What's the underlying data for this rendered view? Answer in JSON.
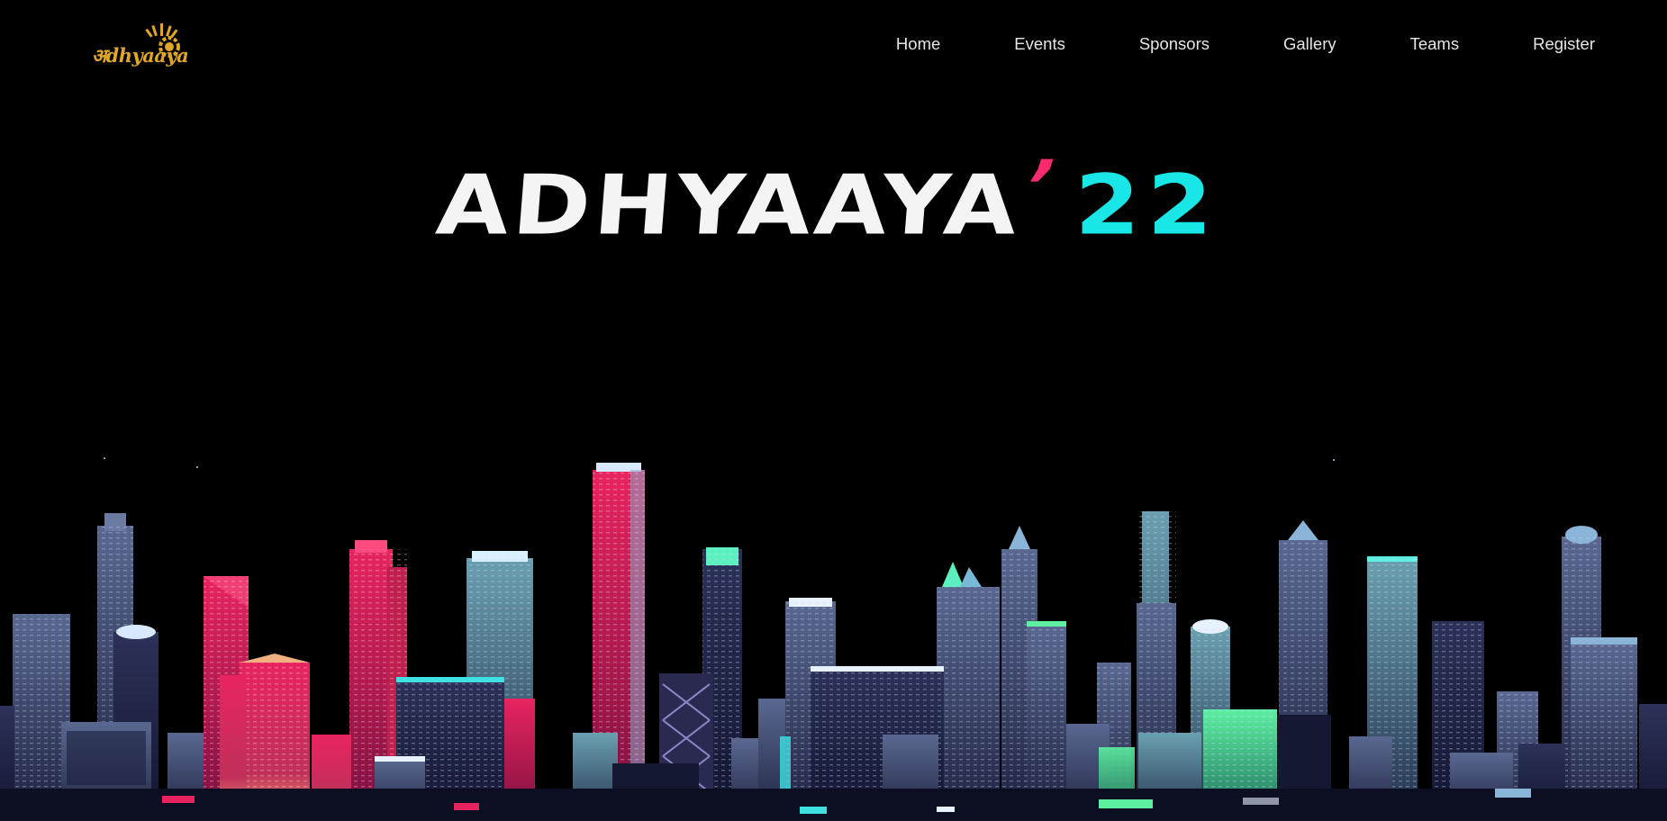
{
  "logo": {
    "text": "अdhyaaya",
    "icon": "sun-crest-icon",
    "color": "#e1a628"
  },
  "nav": {
    "items": [
      {
        "label": "Home"
      },
      {
        "label": "Events"
      },
      {
        "label": "Sponsors"
      },
      {
        "label": "Gallery"
      },
      {
        "label": "Teams"
      },
      {
        "label": "Register"
      }
    ]
  },
  "hero": {
    "title_main": "ADHYAAYA",
    "title_apostrophe": "’",
    "title_year": "22"
  },
  "colors": {
    "background": "#000000",
    "title_main": "#f4f4f4",
    "apostrophe": "#ff2a6d",
    "year": "#19e6e6",
    "nav_text": "#e6e6e6",
    "neon_pink": "#e8245f",
    "neon_cyan": "#3fe0e0",
    "neon_green": "#5cf0a0",
    "building_slate": "#3a4366"
  },
  "illustration": {
    "icon": "pixel-city-skyline-illustration"
  }
}
